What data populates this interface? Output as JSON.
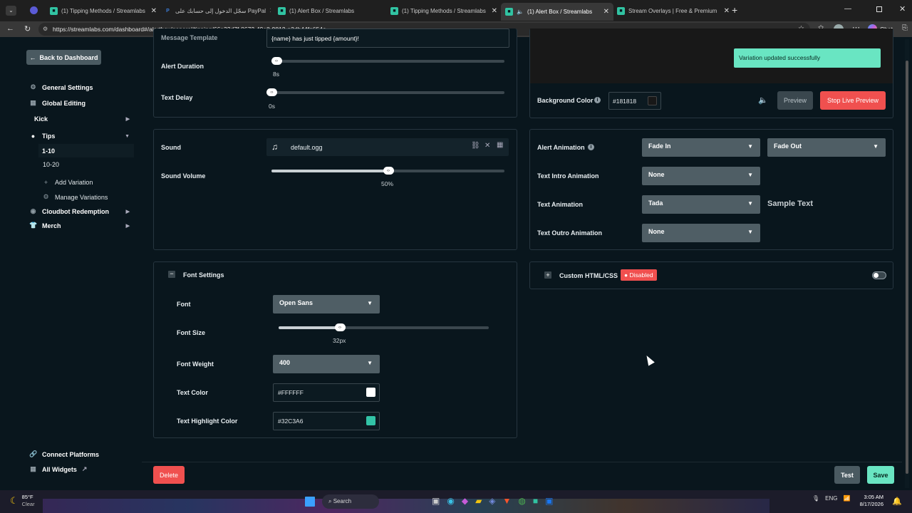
{
  "browser": {
    "tabs": [
      {
        "title": "(1) Tipping Methods / Streamlabs",
        "active": false
      },
      {
        "title": "سجّل الدخول إلى حسابك على PayPal",
        "active": false
      },
      {
        "title": "(1) Alert Box / Streamlabs",
        "active": false
      },
      {
        "title": "(1) Tipping Methods / Streamlabs",
        "active": false
      },
      {
        "title": "(1) Alert Box / Streamlabs",
        "active": true
      },
      {
        "title": "Stream Overlays | Free & Premium",
        "active": false
      }
    ],
    "url": "https://streamlabs.com/dashboard#/alertbox/general/tipping/66a32d7f-8672-49a8-9812-a3db44fe654e",
    "copilot_label": "Chat"
  },
  "sidebar": {
    "back_label": "Back to Dashboard",
    "items": [
      {
        "label": "General Settings",
        "icon": "gear-icon"
      },
      {
        "label": "Global Editing",
        "icon": "grid-icon"
      },
      {
        "label": "Kick",
        "icon": ""
      },
      {
        "label": "Tips",
        "icon": "tips-icon"
      },
      {
        "label": "1-10",
        "icon": ""
      },
      {
        "label": "10-20",
        "icon": ""
      },
      {
        "label": "Add Variation",
        "icon": "plus-icon"
      },
      {
        "label": "Manage Variations",
        "icon": "gear-icon"
      },
      {
        "label": "Cloudbot Redemption",
        "icon": "cloudbot-icon"
      },
      {
        "label": "Merch",
        "icon": "shirt-icon"
      }
    ],
    "connect_platforms": "Connect Platforms",
    "all_widgets": "All Widgets"
  },
  "alert": {
    "message_template_label": "Message Template",
    "message_template_value": "{name} has just tipped {amount}!",
    "alert_duration_label": "Alert Duration",
    "alert_duration_value": "8s",
    "alert_duration_fraction": 0.02,
    "text_delay_label": "Text Delay",
    "text_delay_value": "0s",
    "text_delay_fraction": 0.0
  },
  "sound": {
    "sound_label": "Sound",
    "file": "default.ogg",
    "volume_label": "Sound Volume",
    "volume_value": "50%",
    "volume_fraction": 0.5
  },
  "font": {
    "section_title": "Font Settings",
    "font_label": "Font",
    "font_value": "Open Sans",
    "size_label": "Font Size",
    "size_value": "32px",
    "size_fraction": 0.29,
    "weight_label": "Font Weight",
    "weight_value": "400",
    "text_color_label": "Text Color",
    "text_color_value": "#FFFFFF",
    "highlight_label": "Text Highlight Color",
    "highlight_value": "#32C3A6"
  },
  "preview": {
    "toast": "Variation updated successfully",
    "bg_color_label": "Background Color",
    "bg_color_value": "#181818",
    "preview_btn": "Preview",
    "stop_btn": "Stop Live Preview"
  },
  "animation": {
    "alert_label": "Alert Animation",
    "alert_in": "Fade In",
    "alert_out": "Fade Out",
    "intro_label": "Text Intro Animation",
    "intro_value": "None",
    "text_label": "Text Animation",
    "text_value": "Tada",
    "sample": "Sample Text",
    "outro_label": "Text Outro Animation",
    "outro_value": "None"
  },
  "custom": {
    "title": "Custom HTML/CSS",
    "badge": "Disabled"
  },
  "footer": {
    "delete": "Delete",
    "test": "Test",
    "save": "Save"
  },
  "taskbar": {
    "temp": "85°F",
    "weather": "Clear",
    "search": "Search",
    "lang": "ENG",
    "time": "3:05 AM",
    "date": "8/17/2026"
  },
  "colors": {
    "accent": "#31c3a2",
    "danger": "#f0504f",
    "toast": "#69e5c2"
  }
}
